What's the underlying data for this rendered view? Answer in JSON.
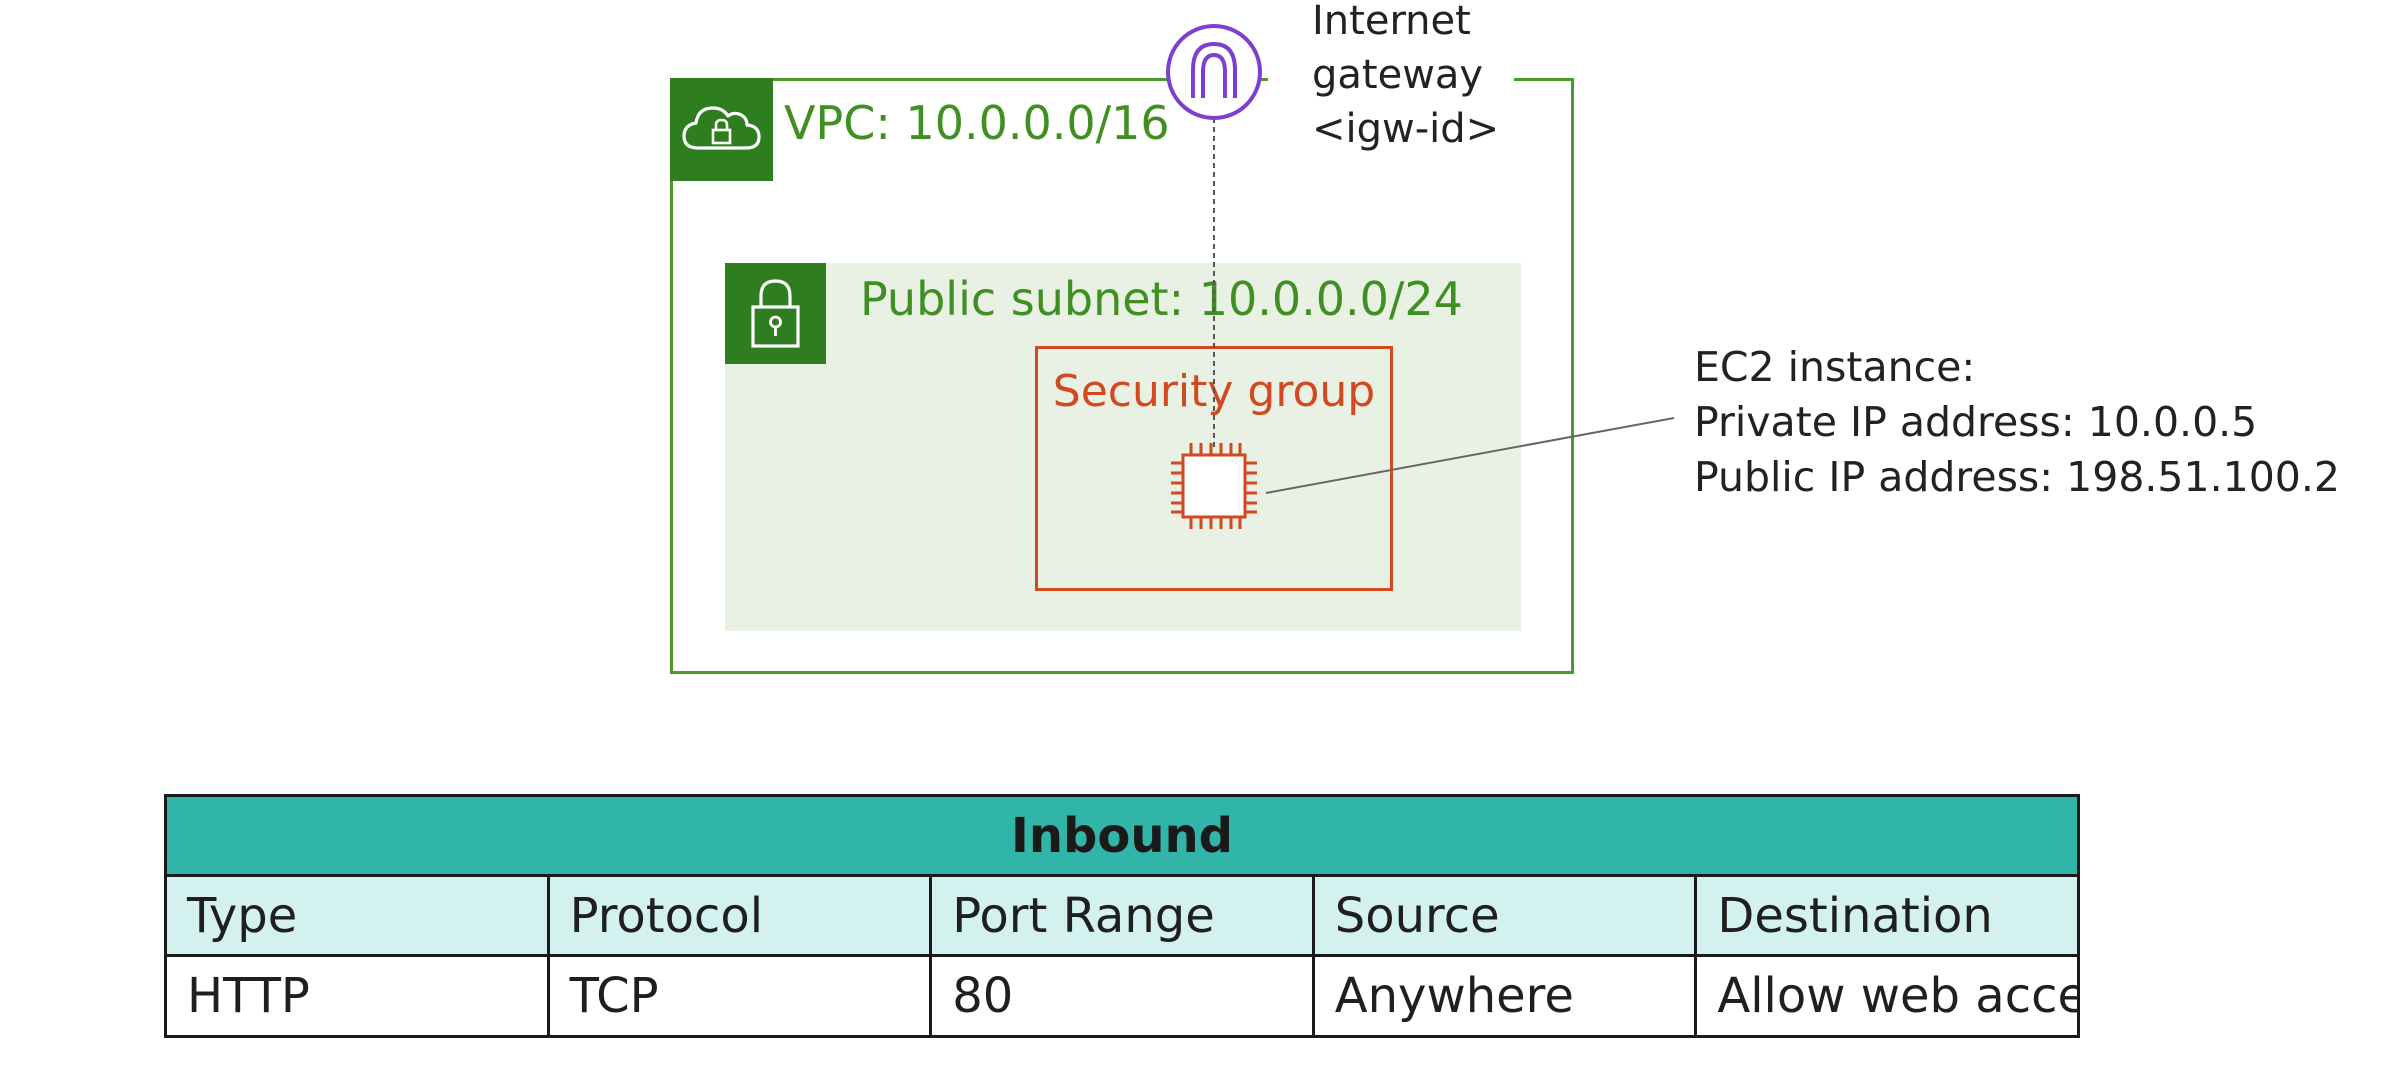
{
  "diagram": {
    "vpc": {
      "label": "VPC: 10.0.0.0/16",
      "icon": "cloud-lock-icon",
      "color": "#3f8f22"
    },
    "subnet": {
      "label": "Public subnet: 10.0.0.0/24",
      "icon": "padlock-icon",
      "color": "#3f8f22",
      "fill": "#e8f1e4"
    },
    "security_group": {
      "label": "Security group",
      "color": "#d2491f"
    },
    "internet_gateway": {
      "line1": "Internet",
      "line2": "gateway",
      "line3": "<igw-id>",
      "icon": "internet-gateway-icon",
      "color": "#7b3fd1"
    },
    "ec2": {
      "icon": "ec2-chip-icon",
      "line1": "EC2 instance:",
      "line2": "Private IP address: 10.0.0.5",
      "line3": "Public IP address: 198.51.100.2"
    }
  },
  "table": {
    "title": "Inbound",
    "title_color": "#31b5a8",
    "header_color": "#d3f1ee",
    "columns": [
      "Type",
      "Protocol",
      "Port Range",
      "Source",
      "Destination"
    ],
    "rows": [
      [
        "HTTP",
        "TCP",
        "80",
        "Anywhere",
        "Allow web access"
      ]
    ]
  }
}
